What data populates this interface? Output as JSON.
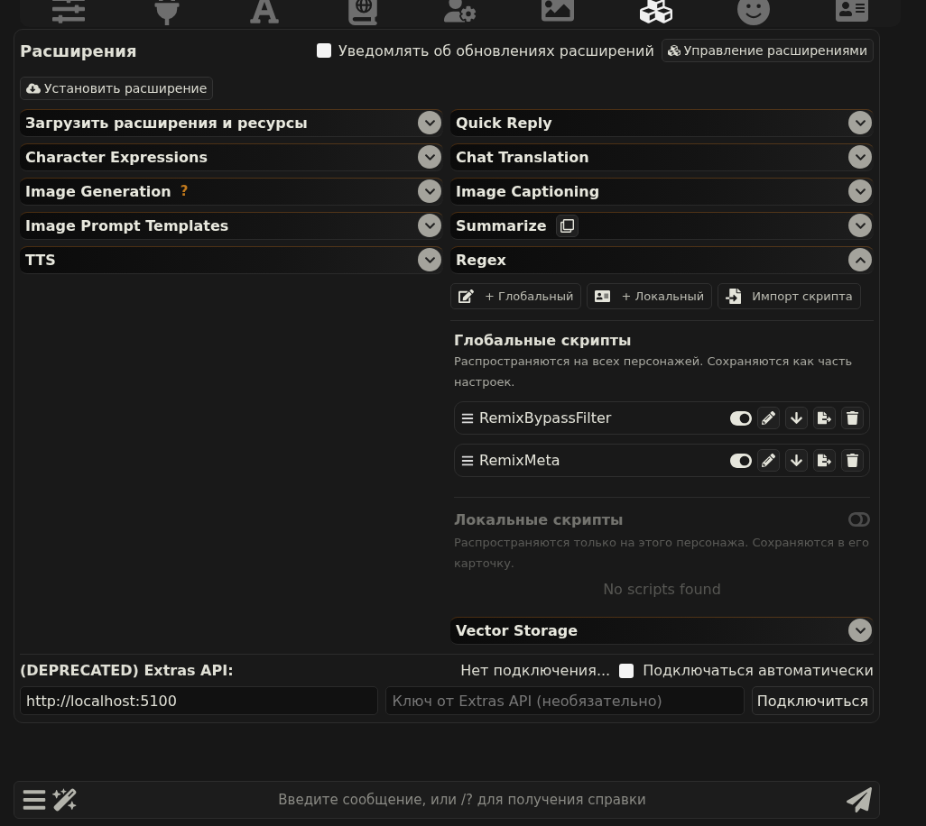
{
  "top_icons": [
    {
      "kind": "sliders",
      "selected": false
    },
    {
      "kind": "plug",
      "selected": false
    },
    {
      "kind": "font",
      "selected": false
    },
    {
      "kind": "book",
      "selected": false
    },
    {
      "kind": "user-gear",
      "selected": false
    },
    {
      "kind": "image",
      "selected": false
    },
    {
      "kind": "cubes",
      "selected": true
    },
    {
      "kind": "smile",
      "selected": false
    },
    {
      "kind": "id-card",
      "selected": false
    }
  ],
  "panel": {
    "title": "Расширения",
    "notify": {
      "label": "Уведомлять об обновлениях расширений",
      "checked": false
    },
    "manage_button": "Управление расширениями",
    "install_button": "Установить расширение"
  },
  "left_drawers": [
    {
      "title": "Загрузить расширения и ресурсы",
      "expanded": false
    },
    {
      "title": "Character Expressions",
      "expanded": false
    },
    {
      "title": "Image Generation",
      "hint": "?",
      "expanded": false
    },
    {
      "title": "Image Prompt Templates",
      "expanded": false
    },
    {
      "title": "TTS",
      "expanded": false
    }
  ],
  "right_drawers": [
    {
      "title": "Quick Reply",
      "expanded": false
    },
    {
      "title": "Chat Translation",
      "expanded": false
    },
    {
      "title": "Image Captioning",
      "expanded": false
    },
    {
      "title": "Summarize",
      "kind": "copy",
      "expanded": false
    },
    {
      "title": "Regex",
      "kind": "regex",
      "expanded": true
    },
    {
      "title": "Vector Storage",
      "expanded": false
    }
  ],
  "regex": {
    "buttons": [
      {
        "kind": "edit",
        "label": "+ Глобальный"
      },
      {
        "kind": "card",
        "label": "+ Локальный"
      },
      {
        "kind": "import",
        "label": "Импорт скрипта"
      }
    ],
    "global": {
      "title": "Глобальные скрипты",
      "description": "Распространяются на всех персонажей. Сохраняются как часть настроек.",
      "scripts": [
        {
          "name": "RemixBypassFilter",
          "enabled": true
        },
        {
          "name": "RemixMeta",
          "enabled": true
        }
      ]
    },
    "local": {
      "title": "Локальные скрипты",
      "description": "Распространяются только на этого персонажа. Сохраняются в его карточку.",
      "enabled": false,
      "empty": "No scripts found"
    }
  },
  "extras": {
    "title": "(DEPRECATED) Extras API:",
    "status": "Нет подключения...",
    "auto_connect": {
      "label": "Подключаться автоматически",
      "checked": false
    },
    "url": "http://localhost:5100",
    "key_placeholder": "Ключ от Extras API (необязательно)",
    "connect_button": "Подключиться"
  },
  "chat": {
    "placeholder": "Введите сообщение, или /? для получения справки"
  }
}
